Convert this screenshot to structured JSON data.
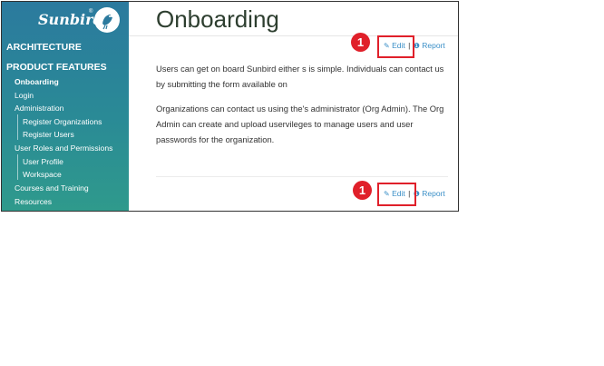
{
  "sidebar": {
    "logo": "Sunbird",
    "logo_tm": "®",
    "sections": [
      {
        "label": "ARCHITECTURE"
      },
      {
        "label": "PRODUCT FEATURES"
      }
    ],
    "items": [
      {
        "label": "Onboarding"
      },
      {
        "label": "Login"
      },
      {
        "label": "Administration"
      },
      {
        "label": "Register Organizations"
      },
      {
        "label": "Register Users"
      },
      {
        "label": "User Roles and Permissions"
      },
      {
        "label": "User Profile"
      },
      {
        "label": "Workspace"
      },
      {
        "label": "Courses and Training"
      },
      {
        "label": "Resources"
      }
    ]
  },
  "main": {
    "title": "Onboarding",
    "edit_label": "Edit",
    "separator": "|",
    "report_label": "Report",
    "paragraph1": "Users can get on board Sunbird either s is simple. Individuals can contact us by submitting the form available on",
    "paragraph2": "Organizations can contact us using the's administrator (Org Admin). The Org Admin can create and upload uservileges to manage users and user passwords for the organization."
  },
  "annotation": {
    "badge": "1",
    "color": "#e0202a"
  },
  "colors": {
    "sidebar": "#2b7a9e",
    "link": "#3a8fc7",
    "highlight": "#e0202a"
  }
}
